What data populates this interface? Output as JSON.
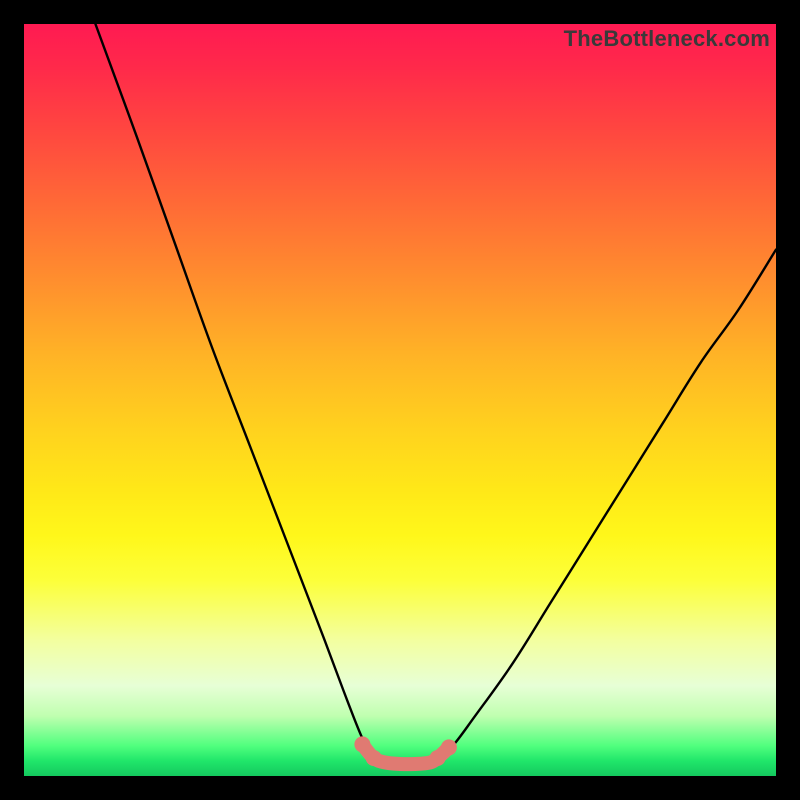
{
  "watermark": {
    "text": "TheBottleneck.com"
  },
  "colors": {
    "frame_bg": "#000000",
    "curve_stroke": "#000000",
    "marker_fill": "#e07a72",
    "marker_stroke": "#d46a62"
  },
  "chart_data": {
    "type": "line",
    "title": "",
    "xlabel": "",
    "ylabel": "",
    "xlim": [
      0,
      100
    ],
    "ylim": [
      0,
      100
    ],
    "grid": false,
    "legend": false,
    "series": [
      {
        "name": "left-curve",
        "x": [
          9.5,
          15,
          20,
          25,
          30,
          35,
          40,
          43,
          45,
          46.5
        ],
        "values": [
          100,
          85,
          71,
          57,
          44,
          31,
          18,
          10,
          5,
          2.4
        ]
      },
      {
        "name": "right-curve",
        "x": [
          55,
          57,
          60,
          65,
          70,
          75,
          80,
          85,
          90,
          95,
          100
        ],
        "values": [
          2.4,
          4,
          8,
          15,
          23,
          31,
          39,
          47,
          55,
          62,
          70
        ]
      },
      {
        "name": "bottom-flat",
        "x": [
          46.5,
          48,
          50,
          52,
          54,
          55
        ],
        "values": [
          2.4,
          1.8,
          1.6,
          1.6,
          1.8,
          2.4
        ]
      }
    ],
    "markers": {
      "name": "minimum-band",
      "x": [
        45.0,
        46.5,
        48.0,
        50.0,
        52.0,
        54.0,
        55.0,
        56.5
      ],
      "values": [
        4.2,
        2.4,
        1.8,
        1.6,
        1.6,
        1.8,
        2.4,
        3.8
      ]
    }
  }
}
